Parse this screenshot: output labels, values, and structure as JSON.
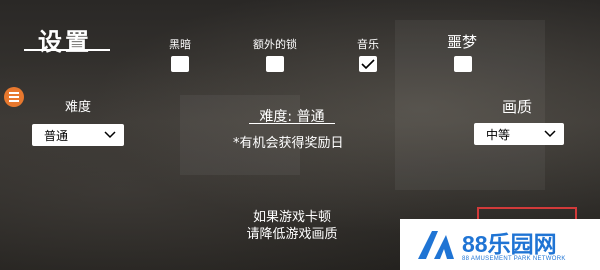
{
  "header": {
    "title": "设置"
  },
  "options": [
    {
      "label": "黑暗",
      "checked": false
    },
    {
      "label": "额外的锁",
      "checked": false
    },
    {
      "label": "音乐",
      "checked": true
    },
    {
      "label": "噩梦",
      "checked": false
    }
  ],
  "difficulty": {
    "label": "难度",
    "selected": "普通"
  },
  "quality": {
    "label": "画质",
    "selected": "中等"
  },
  "center": {
    "difficulty_text": "难度: 普通",
    "reward_note": "*有机会获得奖励日"
  },
  "hint": {
    "line1": "如果游戏卡顿",
    "line2": "请降低游戏画质"
  },
  "watermark": {
    "brand": "88乐园网",
    "sub": "88 AMUSEMENT PARK NETWORK"
  }
}
